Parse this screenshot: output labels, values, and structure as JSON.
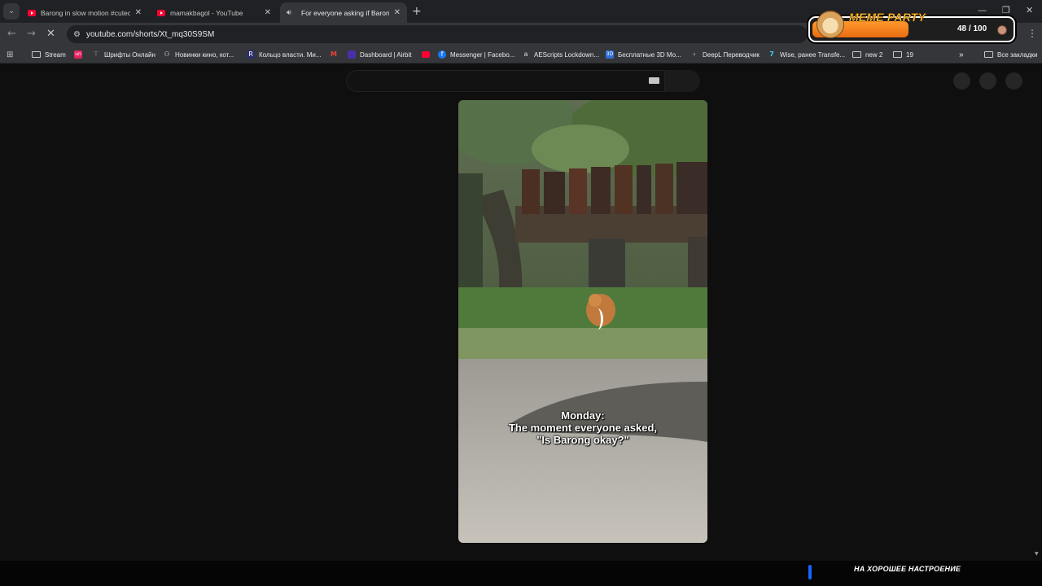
{
  "tabs": [
    {
      "title": "Barong in slow motion #cuteca",
      "icon": "youtube-icon",
      "active": false
    },
    {
      "title": "mamakbagol - YouTube",
      "icon": "youtube-icon",
      "active": false
    },
    {
      "title": "For everyone asking if Barong i",
      "icon": "audio-icon",
      "active": true
    }
  ],
  "address": {
    "url": "youtube.com/shorts/Xt_mq30S9SM"
  },
  "bookmarks": [
    {
      "label": "Stream",
      "icon": "folder-icon"
    },
    {
      "label": "",
      "icon": "app-icon"
    },
    {
      "label": "Шрифты Онлайн",
      "icon": "site-icon"
    },
    {
      "label": "Новинки кино, кот...",
      "icon": "site-icon"
    },
    {
      "label": "Кольцо власти. Ми...",
      "icon": "site-icon"
    },
    {
      "label": "",
      "icon": "gmail-icon"
    },
    {
      "label": "Dashboard | Airbit",
      "icon": "site-icon"
    },
    {
      "label": "",
      "icon": "youtube-icon"
    },
    {
      "label": "Messenger | Facebo...",
      "icon": "facebook-icon"
    },
    {
      "label": "AEScripts Lockdown...",
      "icon": "site-icon"
    },
    {
      "label": "Бесплатные 3D Мо...",
      "icon": "site-icon"
    },
    {
      "label": "DeepL Переводчик",
      "icon": "site-icon"
    },
    {
      "label": "Wise, ранее Transfe...",
      "icon": "site-icon"
    },
    {
      "label": "new 2",
      "icon": "folder-icon"
    },
    {
      "label": "19",
      "icon": "folder-icon"
    }
  ],
  "bookmarks_overflow": "»",
  "all_bookmarks": "Все закладки",
  "meme_party": {
    "title": "MEME PARTY",
    "count": "48 / 100",
    "progress": 0.48
  },
  "video": {
    "caption_lines": [
      "Monday:",
      "The moment everyone asked,",
      "\"Is Barong okay?\""
    ]
  },
  "footer": {
    "text": "НА ХОРОШЕЕ НАСТРОЕНИЕ"
  }
}
